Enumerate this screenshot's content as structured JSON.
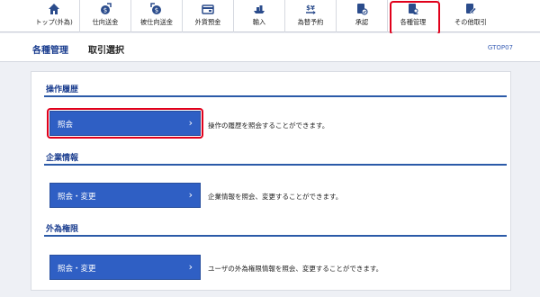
{
  "nav": {
    "items": [
      {
        "label": "トップ(外為)",
        "icon": "home-icon"
      },
      {
        "label": "仕向送金",
        "icon": "outward-remittance-icon"
      },
      {
        "label": "被仕向送金",
        "icon": "inward-remittance-icon"
      },
      {
        "label": "外貨預金",
        "icon": "foreign-deposit-icon"
      },
      {
        "label": "輸入",
        "icon": "import-icon"
      },
      {
        "label": "為替予約",
        "icon": "exchange-contract-icon"
      },
      {
        "label": "承認",
        "icon": "approval-icon"
      },
      {
        "label": "各種管理",
        "icon": "management-icon",
        "active": true
      },
      {
        "label": "その他取引",
        "icon": "other-transactions-icon"
      }
    ]
  },
  "header": {
    "title": "各種管理",
    "subtitle": "取引選択",
    "screen_code": "GTOP07"
  },
  "sections": [
    {
      "heading": "操作履歴",
      "button_label": "照会",
      "description": "操作の履歴を照会することができます。"
    },
    {
      "heading": "企業情報",
      "button_label": "照会・変更",
      "description": "企業情報を照会、変更することができます。"
    },
    {
      "heading": "外為権限",
      "button_label": "照会・変更",
      "description": "ユーザの外為権限情報を照会、変更することができます。"
    }
  ],
  "colors": {
    "accent": "#2f5fc4",
    "highlight": "#e0001b",
    "heading": "#1a3d8f"
  }
}
